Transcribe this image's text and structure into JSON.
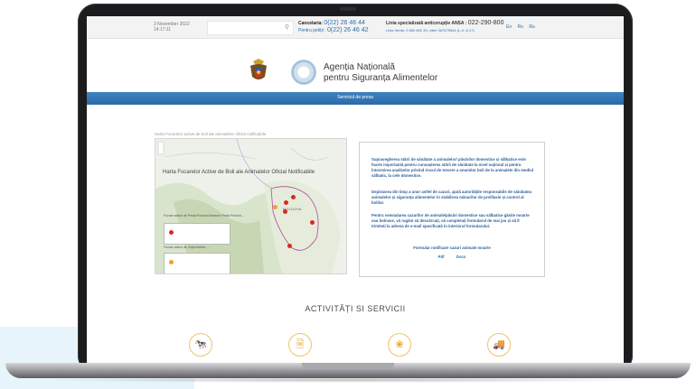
{
  "topbar": {
    "date": "3 November 2022",
    "time": "14:17:11",
    "cancel_label": "Cancelaria:",
    "cancel_phone": "0(22) 26 46 44",
    "petitions_label": "Pentru petiții :",
    "petitions_phone": "0(22) 26 46 42",
    "hotline_label": "Linia specializată anticorupție ANSA :",
    "hotline_phone": "022-290-800",
    "green_line": "Linia Verde: 0 800 800 33; viber 067675544 (L-V: 8-17)",
    "languages": [
      "En",
      "Ro",
      "Ru"
    ]
  },
  "header": {
    "agency_line1": "Agenția Națională",
    "agency_line2": "pentru Siguranța Alimentelor"
  },
  "nav": {
    "label": "Serviciul de presa"
  },
  "map": {
    "caption": "Harta Focarelor active de boli ale animalelor oficial notificabile",
    "title": "Harta Focarelor Active de Boli ale Animalelor Oficial Notificabile",
    "legend1": "Focare active de Pesta Porcina Africana/ Pesta Porcina ...",
    "legend2": "Focare active de Gripa Aviara ....",
    "country_label": "MOLDOVA",
    "outbreak_color": "#d62b1f",
    "avian_color": "#f0a030"
  },
  "info": {
    "p1": "Supravegherea stării de sănătate a animalelor/ păsărilor domestice și sălbatice este foarte importantă pentru cunoașterea stării de sănătate la nivel național și pentru întocmirea analizelor privind riscul de trecere a anumitor boli de la animalele din mediul sălbatic, la cele domestice.",
    "p2": "Depistarea din timp a unor astfel de cazuri, ajută autoritățile responsabile de sănătatea animalelor și siguranța alimentelor în stabilirea măsurilor de profilaxie și control al bolilor.",
    "p3": "Pentru semnalarea cazurilor de animale/păsări domestice sau sălbatice găsite moarte sau bolnave, vă rugăm să descărcați, să completați formularul de mai jos și să îl trimiteți la adresa de e-mail specificată în interiorul formularului.",
    "form_title": "Formular notificare cazuri animale moarte",
    "link_pdf": "Pdf",
    "link_docx": "Docx",
    "text_color": "#2c5e9a"
  },
  "activities": {
    "title": "ACTIVITĂȚI SI SERVICII",
    "icons": [
      "livestock-icon",
      "document-icon",
      "plant-icon",
      "truck-icon"
    ]
  },
  "colors": {
    "nav_blue": "#2a6aa8",
    "accent_orange": "#eea22e",
    "laptop_frame": "#1c1c1e"
  }
}
